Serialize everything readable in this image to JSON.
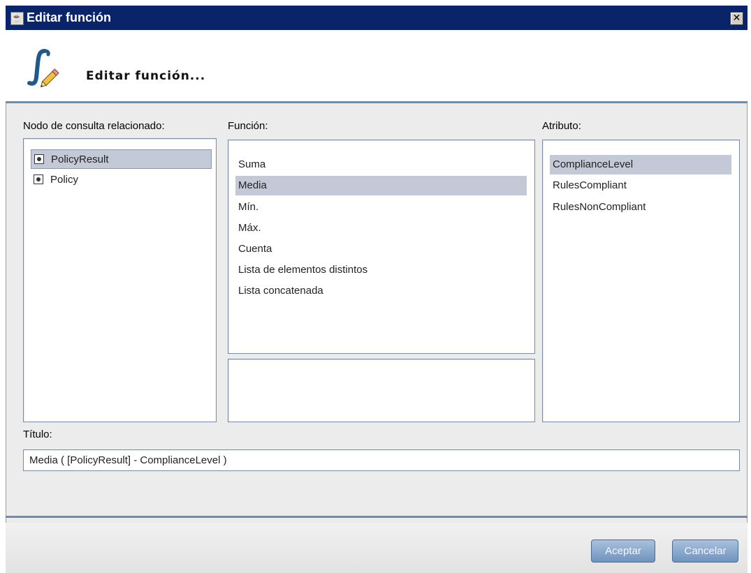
{
  "window": {
    "title": "Editar función",
    "java_icon": "java-cup-icon",
    "close_glyph": "✕"
  },
  "header": {
    "title": "Editar función...",
    "icon": "function-edit-icon"
  },
  "labels": {
    "node": "Nodo de consulta relacionado:",
    "function": "Función:",
    "attribute": "Atributo:",
    "title": "Título:"
  },
  "nodes": [
    {
      "label": "PolicyResult",
      "icon": "node-icon",
      "selected": true
    },
    {
      "label": "Policy",
      "icon": "node-icon",
      "selected": false
    }
  ],
  "functions": [
    {
      "label": "Suma",
      "selected": false
    },
    {
      "label": "Media",
      "selected": true
    },
    {
      "label": "Mín.",
      "selected": false
    },
    {
      "label": "Máx.",
      "selected": false
    },
    {
      "label": "Cuenta",
      "selected": false
    },
    {
      "label": "Lista de elementos distintos",
      "selected": false
    },
    {
      "label": "Lista concatenada",
      "selected": false
    }
  ],
  "attributes": [
    {
      "label": "ComplianceLevel",
      "selected": true
    },
    {
      "label": "RulesCompliant",
      "selected": false
    },
    {
      "label": "RulesNonCompliant",
      "selected": false
    }
  ],
  "title_value": "Media ( [PolicyResult] - ComplianceLevel )",
  "buttons": {
    "accept": "Aceptar",
    "cancel": "Cancelar"
  },
  "colors": {
    "titlebar": "#0a246a",
    "selection": "#c3c9d6",
    "button": "#7d9ec6"
  }
}
